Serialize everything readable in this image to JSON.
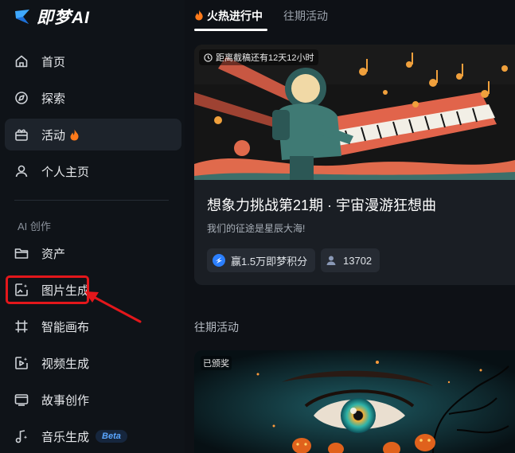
{
  "app": {
    "name": "即梦AI"
  },
  "sidebar": {
    "items": [
      {
        "label": "首页",
        "icon": "home-icon"
      },
      {
        "label": "探索",
        "icon": "compass-icon"
      },
      {
        "label": "活动",
        "icon": "gift-icon",
        "active": true
      },
      {
        "label": "个人主页",
        "icon": "user-icon"
      }
    ],
    "section_title": "AI 创作",
    "create_items": [
      {
        "label": "资产",
        "icon": "folder-icon"
      },
      {
        "label": "图片生成",
        "icon": "image-gen-icon"
      },
      {
        "label": "智能画布",
        "icon": "canvas-icon"
      },
      {
        "label": "视频生成",
        "icon": "video-icon"
      },
      {
        "label": "故事创作",
        "icon": "story-icon"
      },
      {
        "label": "音乐生成",
        "icon": "music-icon",
        "badge": "Beta"
      }
    ]
  },
  "tabs": [
    {
      "label": "火热进行中",
      "active": true
    },
    {
      "label": "往期活动",
      "active": false
    }
  ],
  "featured": {
    "countdown": "距离截稿还有12天12小时",
    "title": "想象力挑战第21期 · 宇宙漫游狂想曲",
    "subtitle": "我们的征途是星辰大海!",
    "reward": "赢1.5万即梦积分",
    "participants": "13702"
  },
  "past": {
    "section_title": "往期活动",
    "badge": "已颁奖"
  },
  "colors": {
    "accent_highlight": "#e3171b",
    "fire": "#ff7a1a",
    "background": "#0e1116"
  }
}
